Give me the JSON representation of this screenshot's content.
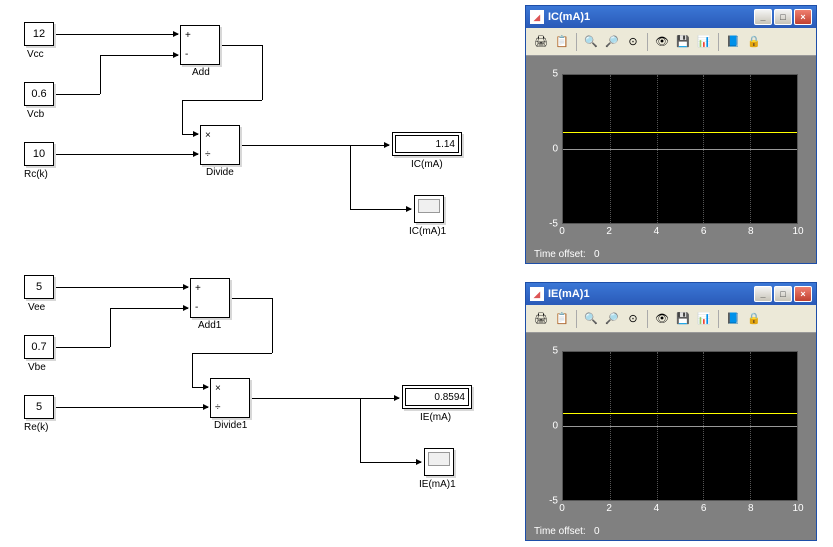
{
  "ic_circuit": {
    "vcc_value": "12",
    "vcc_label": "Vcc",
    "vcb_value": "0.6",
    "vcb_label": "Vcb",
    "rc_value": "10",
    "rc_label": "Rc(k)",
    "add_sign1": "+",
    "add_sign2": "-",
    "add_label": "Add",
    "divide_op1": "×",
    "divide_op2": "÷",
    "divide_label": "Divide",
    "display_value": "1.14",
    "display_label": "IC(mA)",
    "scope_label": "IC(mA)1"
  },
  "ie_circuit": {
    "vee_value": "5",
    "vee_label": "Vee",
    "vbe_value": "0.7",
    "vbe_label": "Vbe",
    "re_value": "5",
    "re_label": "Re(k)",
    "add_sign1": "+",
    "add_sign2": "-",
    "add_label": "Add1",
    "divide_op1": "×",
    "divide_op2": "÷",
    "divide_label": "Divide1",
    "display_value": "0.8594",
    "display_label": "IE(mA)",
    "scope_label": "IE(mA)1"
  },
  "scope_ic": {
    "title": "IC(mA)1",
    "time_offset_label": "Time offset:",
    "time_offset_value": "0"
  },
  "scope_ie": {
    "title": "IE(mA)1",
    "time_offset_label": "Time offset:",
    "time_offset_value": "0"
  },
  "window_buttons": {
    "minimize": "_",
    "maximize": "□",
    "close": "×"
  },
  "toolbar_icons": {
    "print": "🖨",
    "params": "📋",
    "zoom_in": "🔍",
    "zoom_x": "🔎",
    "zoom_y": "⊙",
    "autoscale": "👁",
    "save": "💾",
    "restore": "📊",
    "float": "📘",
    "lock": "🔒"
  },
  "chart_data": [
    {
      "type": "line",
      "title": "IC(mA)1",
      "xlabel": "",
      "ylabel": "",
      "xlim": [
        0,
        10
      ],
      "ylim": [
        -5,
        5
      ],
      "x_ticks": [
        0,
        2,
        4,
        6,
        8,
        10
      ],
      "y_ticks": [
        -5,
        0,
        5
      ],
      "series": [
        {
          "name": "IC(mA)",
          "color": "#ffff00",
          "values": [
            1.14,
            1.14
          ],
          "x": [
            0,
            10
          ]
        }
      ]
    },
    {
      "type": "line",
      "title": "IE(mA)1",
      "xlabel": "",
      "ylabel": "",
      "xlim": [
        0,
        10
      ],
      "ylim": [
        -5,
        5
      ],
      "x_ticks": [
        0,
        2,
        4,
        6,
        8,
        10
      ],
      "y_ticks": [
        -5,
        0,
        5
      ],
      "series": [
        {
          "name": "IE(mA)",
          "color": "#ffff00",
          "values": [
            0.8594,
            0.8594
          ],
          "x": [
            0,
            10
          ]
        }
      ]
    }
  ]
}
